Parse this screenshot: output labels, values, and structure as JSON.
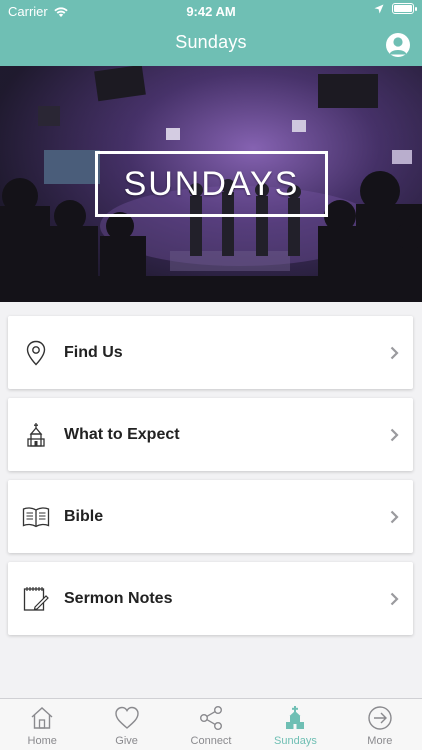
{
  "status_bar": {
    "carrier": "Carrier",
    "time": "9:42 AM"
  },
  "nav": {
    "title": "Sundays"
  },
  "hero": {
    "badge_text": "SUNDAYS"
  },
  "menu": {
    "items": [
      {
        "label": "Find Us",
        "icon": "location-pin-icon"
      },
      {
        "label": "What to Expect",
        "icon": "church-icon"
      },
      {
        "label": "Bible",
        "icon": "open-book-icon"
      },
      {
        "label": "Sermon Notes",
        "icon": "notepad-icon"
      }
    ]
  },
  "tabbar": {
    "tabs": [
      {
        "label": "Home",
        "icon": "house-icon",
        "active": false
      },
      {
        "label": "Give",
        "icon": "heart-icon",
        "active": false
      },
      {
        "label": "Connect",
        "icon": "share-icon",
        "active": false
      },
      {
        "label": "Sundays",
        "icon": "church-icon",
        "active": true
      },
      {
        "label": "More",
        "icon": "arrow-circle-icon",
        "active": false
      }
    ]
  },
  "colors": {
    "accent": "#6fbfb4",
    "text_dark": "#222222",
    "tab_inactive": "#8a8a8e"
  }
}
